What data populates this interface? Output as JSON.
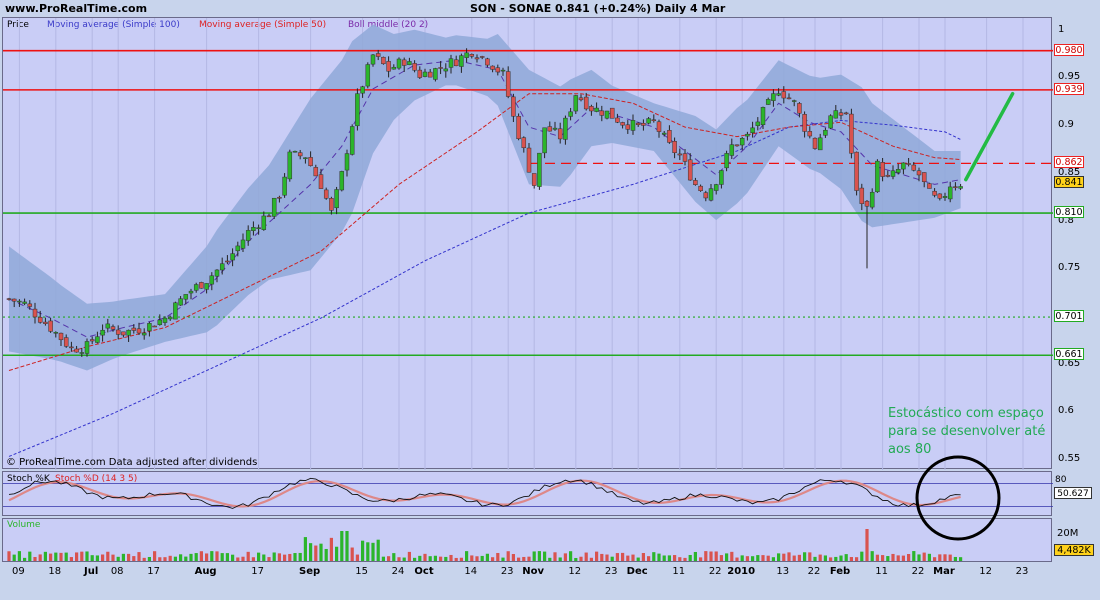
{
  "header": {
    "site": "www.ProRealTime.com",
    "title": "SON - SONAE   0.841 (+0.24%)   Daily  4 Mar"
  },
  "legend": {
    "price": "Price",
    "ma100": "Moving average (Simple 100)",
    "ma50": "Moving average (Simple 50)",
    "boll": "Boll middle (20 2)"
  },
  "copyright": "© ProRealTime.com Data adjusted after dividends",
  "annotation": "Estocástico com espaço para se desenvolver até aos 80",
  "stoch": {
    "label_k": "Stoch %K",
    "label_d": "Stoch %D (14 3 5)",
    "level_80": "80",
    "value": "50.627"
  },
  "volume": {
    "label": "Volume",
    "axis_20m": "20M",
    "value": "4,482K"
  },
  "colors": {
    "up": "#2bb52b",
    "down": "#d9534f",
    "ma100": "#3333cc",
    "ma50": "#cc2222",
    "band": "#8fa8d8",
    "hline_red": "#ee1111",
    "hline_green": "#22aa22",
    "annot_green": "#22aa55",
    "circle": "#000000"
  },
  "chart_data": {
    "type": "line",
    "series_kind": "candlestick",
    "symbol": "SON - SONAE",
    "last": 0.841,
    "change_pct": "+0.24%",
    "ylim": [
      0.54,
      1.0
    ],
    "yticks": [
      "1",
      "0.95",
      "0.9",
      "0.85",
      "0.8",
      "0.75",
      "0.7",
      "0.65",
      "0.6",
      "0.55"
    ],
    "price_labels": [
      {
        "value": "0.980",
        "style": "red"
      },
      {
        "value": "0.939",
        "style": "red"
      },
      {
        "value": "0.862",
        "style": "red"
      },
      {
        "value": "0.841",
        "style": "current"
      },
      {
        "value": "0.810",
        "style": "green"
      },
      {
        "value": "0.701",
        "style": "green"
      },
      {
        "value": "0.661",
        "style": "green"
      }
    ],
    "horizontal_lines": [
      {
        "value": 0.98,
        "color": "red",
        "style": "solid"
      },
      {
        "value": 0.939,
        "color": "red",
        "style": "solid"
      },
      {
        "value": 0.862,
        "color": "red",
        "style": "dashed"
      },
      {
        "value": 0.81,
        "color": "green",
        "style": "solid"
      },
      {
        "value": 0.701,
        "color": "green",
        "style": "dotted"
      },
      {
        "value": 0.661,
        "color": "green",
        "style": "solid"
      }
    ],
    "xlabels": [
      {
        "t": "09",
        "i": 2,
        "b": false
      },
      {
        "t": "18",
        "i": 9,
        "b": false
      },
      {
        "t": "Jul",
        "i": 16,
        "b": true
      },
      {
        "t": "08",
        "i": 21,
        "b": false
      },
      {
        "t": "17",
        "i": 28,
        "b": false
      },
      {
        "t": "Aug",
        "i": 38,
        "b": true
      },
      {
        "t": "17",
        "i": 48,
        "b": false
      },
      {
        "t": "Sep",
        "i": 58,
        "b": true
      },
      {
        "t": "15",
        "i": 68,
        "b": false
      },
      {
        "t": "24",
        "i": 75,
        "b": false
      },
      {
        "t": "Oct",
        "i": 80,
        "b": true
      },
      {
        "t": "14",
        "i": 89,
        "b": false
      },
      {
        "t": "23",
        "i": 96,
        "b": false
      },
      {
        "t": "Nov",
        "i": 101,
        "b": true
      },
      {
        "t": "12",
        "i": 109,
        "b": false
      },
      {
        "t": "23",
        "i": 116,
        "b": false
      },
      {
        "t": "Dec",
        "i": 121,
        "b": true
      },
      {
        "t": "11",
        "i": 129,
        "b": false
      },
      {
        "t": "22",
        "i": 136,
        "b": false
      },
      {
        "t": "2010",
        "i": 141,
        "b": true
      },
      {
        "t": "13",
        "i": 149,
        "b": false
      },
      {
        "t": "22",
        "i": 155,
        "b": false
      },
      {
        "t": "Feb",
        "i": 160,
        "b": true
      },
      {
        "t": "11",
        "i": 168,
        "b": false
      },
      {
        "t": "22",
        "i": 175,
        "b": false
      },
      {
        "t": "Mar",
        "i": 180,
        "b": true
      },
      {
        "t": "12",
        "i": 188,
        "b": false
      },
      {
        "t": "23",
        "i": 195,
        "b": false
      }
    ],
    "close_anchors": [
      [
        0,
        0.72
      ],
      [
        3,
        0.715
      ],
      [
        8,
        0.69
      ],
      [
        12,
        0.668
      ],
      [
        15,
        0.67
      ],
      [
        18,
        0.69
      ],
      [
        22,
        0.685
      ],
      [
        26,
        0.69
      ],
      [
        30,
        0.7
      ],
      [
        34,
        0.725
      ],
      [
        38,
        0.74
      ],
      [
        42,
        0.76
      ],
      [
        46,
        0.79
      ],
      [
        50,
        0.81
      ],
      [
        52,
        0.83
      ],
      [
        54,
        0.87
      ],
      [
        57,
        0.87
      ],
      [
        60,
        0.84
      ],
      [
        62,
        0.81
      ],
      [
        64,
        0.85
      ],
      [
        67,
        0.93
      ],
      [
        70,
        0.975
      ],
      [
        73,
        0.96
      ],
      [
        76,
        0.97
      ],
      [
        79,
        0.955
      ],
      [
        82,
        0.96
      ],
      [
        86,
        0.97
      ],
      [
        89,
        0.98
      ],
      [
        92,
        0.97
      ],
      [
        95,
        0.955
      ],
      [
        97,
        0.91
      ],
      [
        99,
        0.875
      ],
      [
        101,
        0.84
      ],
      [
        103,
        0.9
      ],
      [
        106,
        0.89
      ],
      [
        109,
        0.935
      ],
      [
        112,
        0.92
      ],
      [
        115,
        0.915
      ],
      [
        118,
        0.905
      ],
      [
        121,
        0.9
      ],
      [
        124,
        0.905
      ],
      [
        127,
        0.88
      ],
      [
        129,
        0.87
      ],
      [
        132,
        0.84
      ],
      [
        134,
        0.83
      ],
      [
        136,
        0.845
      ],
      [
        139,
        0.88
      ],
      [
        142,
        0.89
      ],
      [
        145,
        0.915
      ],
      [
        148,
        0.94
      ],
      [
        151,
        0.925
      ],
      [
        153,
        0.9
      ],
      [
        155,
        0.88
      ],
      [
        158,
        0.91
      ],
      [
        161,
        0.915
      ],
      [
        163,
        0.83
      ],
      [
        165,
        0.815
      ],
      [
        167,
        0.86
      ],
      [
        169,
        0.845
      ],
      [
        172,
        0.86
      ],
      [
        175,
        0.85
      ],
      [
        177,
        0.83
      ],
      [
        179,
        0.82
      ],
      [
        181,
        0.84
      ],
      [
        183,
        0.841
      ]
    ],
    "ma50": [
      [
        0,
        0.645
      ],
      [
        15,
        0.67
      ],
      [
        30,
        0.69
      ],
      [
        45,
        0.73
      ],
      [
        60,
        0.77
      ],
      [
        75,
        0.84
      ],
      [
        90,
        0.895
      ],
      [
        100,
        0.935
      ],
      [
        110,
        0.935
      ],
      [
        120,
        0.925
      ],
      [
        130,
        0.9
      ],
      [
        140,
        0.89
      ],
      [
        150,
        0.9
      ],
      [
        160,
        0.905
      ],
      [
        170,
        0.88
      ],
      [
        178,
        0.868
      ],
      [
        183,
        0.866
      ]
    ],
    "ma100": [
      [
        0,
        0.555
      ],
      [
        20,
        0.6
      ],
      [
        40,
        0.65
      ],
      [
        60,
        0.7
      ],
      [
        80,
        0.76
      ],
      [
        100,
        0.81
      ],
      [
        120,
        0.84
      ],
      [
        140,
        0.875
      ],
      [
        150,
        0.9
      ],
      [
        160,
        0.907
      ],
      [
        170,
        0.902
      ],
      [
        180,
        0.895
      ],
      [
        183,
        0.887
      ]
    ],
    "boll_middle": [
      [
        0,
        0.72
      ],
      [
        8,
        0.7
      ],
      [
        15,
        0.68
      ],
      [
        22,
        0.69
      ],
      [
        30,
        0.7
      ],
      [
        38,
        0.73
      ],
      [
        46,
        0.78
      ],
      [
        52,
        0.81
      ],
      [
        58,
        0.84
      ],
      [
        64,
        0.88
      ],
      [
        70,
        0.94
      ],
      [
        78,
        0.965
      ],
      [
        86,
        0.97
      ],
      [
        94,
        0.96
      ],
      [
        100,
        0.9
      ],
      [
        106,
        0.89
      ],
      [
        112,
        0.92
      ],
      [
        118,
        0.91
      ],
      [
        124,
        0.9
      ],
      [
        130,
        0.875
      ],
      [
        136,
        0.85
      ],
      [
        142,
        0.88
      ],
      [
        148,
        0.925
      ],
      [
        154,
        0.905
      ],
      [
        160,
        0.895
      ],
      [
        166,
        0.86
      ],
      [
        172,
        0.85
      ],
      [
        178,
        0.84
      ],
      [
        183,
        0.845
      ]
    ],
    "boll_width": [
      [
        0,
        0.055
      ],
      [
        10,
        0.04
      ],
      [
        20,
        0.03
      ],
      [
        30,
        0.025
      ],
      [
        40,
        0.05
      ],
      [
        50,
        0.06
      ],
      [
        58,
        0.09
      ],
      [
        66,
        0.09
      ],
      [
        74,
        0.045
      ],
      [
        84,
        0.025
      ],
      [
        92,
        0.03
      ],
      [
        100,
        0.06
      ],
      [
        108,
        0.05
      ],
      [
        116,
        0.03
      ],
      [
        124,
        0.025
      ],
      [
        132,
        0.045
      ],
      [
        140,
        0.05
      ],
      [
        148,
        0.045
      ],
      [
        156,
        0.05
      ],
      [
        164,
        0.07
      ],
      [
        172,
        0.05
      ],
      [
        178,
        0.035
      ],
      [
        183,
        0.03
      ]
    ],
    "trend_arrow": {
      "from": [
        184,
        0.845
      ],
      "to": [
        193,
        0.935
      ]
    }
  }
}
